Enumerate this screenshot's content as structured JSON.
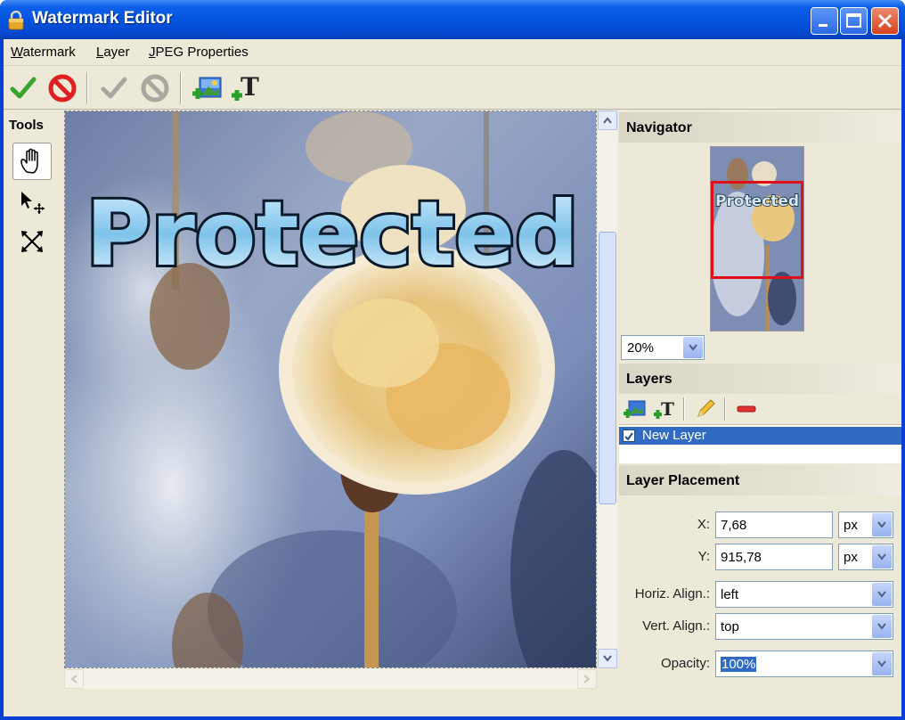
{
  "window": {
    "title": "Watermark Editor"
  },
  "menu": [
    {
      "key": "W",
      "rest": "atermark"
    },
    {
      "key": "L",
      "rest": "ayer"
    },
    {
      "key": "J",
      "rest": "PEG Properties"
    }
  ],
  "toolbar": {
    "buttons": [
      "apply-icon",
      "cancel-icon",
      "apply-disabled-icon",
      "cancel-disabled-icon",
      "add-image-layer-icon",
      "add-text-layer-icon"
    ]
  },
  "tools": {
    "label": "Tools",
    "items": [
      "hand-tool-icon",
      "move-tool-icon",
      "fit-tool-icon"
    ]
  },
  "canvas": {
    "watermark_text": "Protected"
  },
  "navigator": {
    "title": "Navigator",
    "zoom": "20%",
    "thumb_text": "Protected"
  },
  "layers": {
    "title": "Layers",
    "items": [
      {
        "label": "New Layer",
        "checked": true
      }
    ]
  },
  "placement": {
    "title": "Layer Placement",
    "x_label": "X:",
    "x_value": "7,68",
    "x_unit": "px",
    "y_label": "Y:",
    "y_value": "915,78",
    "y_unit": "px",
    "halign_label": "Horiz. Align.:",
    "halign_value": "left",
    "valign_label": "Vert. Align.:",
    "valign_value": "top",
    "opacity_label": "Opacity:",
    "opacity_value": "100%"
  },
  "colors": {
    "titlebar": "#0554e0",
    "client": "#ece9d8",
    "selection": "#316ac5",
    "nav_frame": "#e0101a"
  }
}
